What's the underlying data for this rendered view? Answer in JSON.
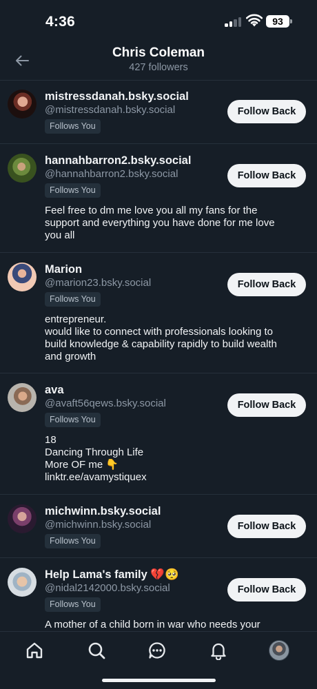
{
  "status_bar": {
    "time": "4:36",
    "battery": "93"
  },
  "header": {
    "title": "Chris Coleman",
    "subtitle": "427 followers"
  },
  "follow_label": "Follow Back",
  "badge_label": "Follows You",
  "followers": [
    {
      "name": "mistressdanah.bsky.social",
      "handle": "@mistressdanah.bsky.social",
      "bio": []
    },
    {
      "name": "hannahbarron2.bsky.social",
      "handle": "@hannahbarron2.bsky.social",
      "bio": [
        "Feel free to dm me love you all my fans for the",
        "support and everything you have done for me love",
        "you all"
      ]
    },
    {
      "name": "Marion",
      "handle": "@marion23.bsky.social",
      "bio": [
        "entrepreneur.",
        "would like to connect with professionals looking to",
        "build knowledge & capability rapidly to build wealth",
        "and growth"
      ]
    },
    {
      "name": "ava",
      "handle": "@avaft56qews.bsky.social",
      "bio": [
        "18",
        "Dancing Through Life",
        "More OF me 👇",
        "linktr.ee/avamystiquex"
      ]
    },
    {
      "name": "michwinn.bsky.social",
      "handle": "@michwinn.bsky.social",
      "bio": []
    },
    {
      "name": "Help Lama's family 💔🥺",
      "handle": "@nidal2142000.bsky.social",
      "bio": [
        "A mother of a child born in war who needs your"
      ]
    }
  ],
  "tabs": [
    "home-icon",
    "search-icon",
    "chat-icon",
    "bell-icon",
    "profile-avatar"
  ],
  "colors": {
    "background": "#161e27",
    "divider": "#26303b",
    "muted_text": "#8d98a5",
    "button_bg": "#f1f3f5"
  }
}
